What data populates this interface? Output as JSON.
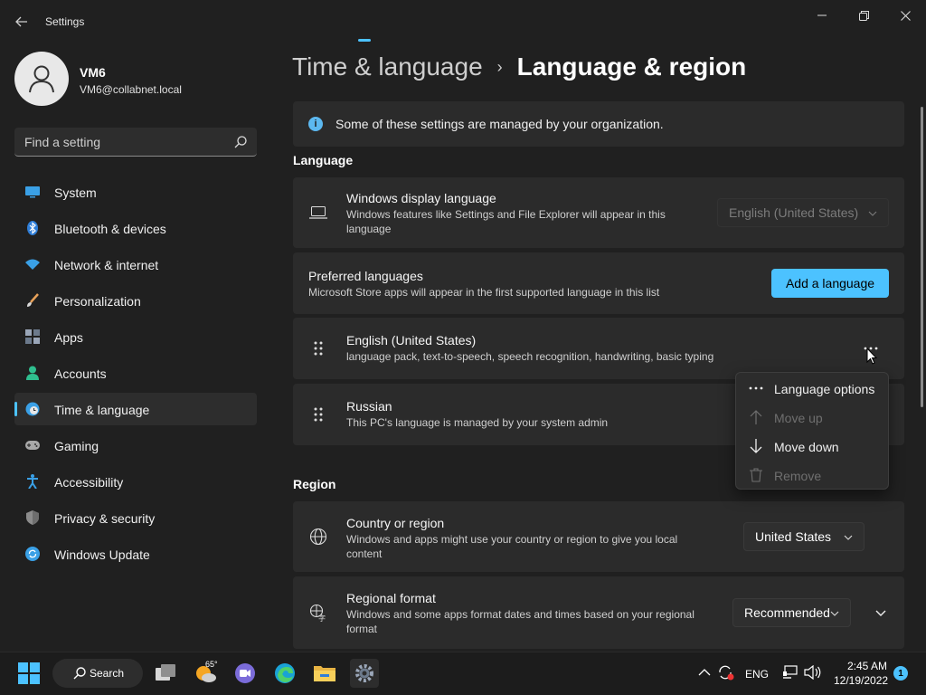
{
  "window": {
    "title": "Settings",
    "controls": [
      "minimize",
      "maximize",
      "close"
    ]
  },
  "profile": {
    "name": "VM6",
    "email": "VM6@collabnet.local"
  },
  "search": {
    "placeholder": "Find a setting",
    "value": ""
  },
  "sidebar": {
    "items": [
      {
        "label": "System",
        "icon": "monitor-icon",
        "active": false
      },
      {
        "label": "Bluetooth & devices",
        "icon": "bluetooth-icon",
        "active": false
      },
      {
        "label": "Network & internet",
        "icon": "wifi-icon",
        "active": false
      },
      {
        "label": "Personalization",
        "icon": "brush-icon",
        "active": false
      },
      {
        "label": "Apps",
        "icon": "apps-icon",
        "active": false
      },
      {
        "label": "Accounts",
        "icon": "person-icon",
        "active": false
      },
      {
        "label": "Time & language",
        "icon": "clock-globe-icon",
        "active": true
      },
      {
        "label": "Gaming",
        "icon": "gamepad-icon",
        "active": false
      },
      {
        "label": "Accessibility",
        "icon": "accessibility-icon",
        "active": false
      },
      {
        "label": "Privacy & security",
        "icon": "shield-icon",
        "active": false
      },
      {
        "label": "Windows Update",
        "icon": "update-icon",
        "active": false
      }
    ]
  },
  "breadcrumb": {
    "parent": "Time & language",
    "separator": "›",
    "current": "Language & region"
  },
  "info_bar": {
    "text": "Some of these settings are managed by your organization."
  },
  "language_section": {
    "heading": "Language",
    "display_language": {
      "title": "Windows display language",
      "description": "Windows features like Settings and File Explorer will appear in this language",
      "value": "English (United States)"
    },
    "preferred": {
      "title": "Preferred languages",
      "description": "Microsoft Store apps will appear in the first supported language in this list",
      "add_button": "Add a language"
    },
    "languages": [
      {
        "name": "English (United States)",
        "description": "language pack, text-to-speech, speech recognition, handwriting, basic typing"
      },
      {
        "name": "Russian",
        "description": "This PC's language is managed by your system admin"
      }
    ]
  },
  "context_menu": {
    "items": [
      {
        "label": "Language options",
        "icon": "more-icon",
        "enabled": true
      },
      {
        "label": "Move up",
        "icon": "arrow-up-icon",
        "enabled": false
      },
      {
        "label": "Move down",
        "icon": "arrow-down-icon",
        "enabled": true
      },
      {
        "label": "Remove",
        "icon": "trash-icon",
        "enabled": false
      }
    ]
  },
  "region_section": {
    "heading": "Region",
    "country": {
      "title": "Country or region",
      "description": "Windows and apps might use your country or region to give you local content",
      "value": "United States"
    },
    "format": {
      "title": "Regional format",
      "description": "Windows and some apps format dates and times based on your regional format",
      "value": "Recommended"
    }
  },
  "taskbar": {
    "search_label": "Search",
    "weather_temp": "65°",
    "language": "ENG",
    "time": "2:45 AM",
    "date": "12/19/2022",
    "notification_count": "1"
  },
  "colors": {
    "accent": "#4cc2ff",
    "background": "#202020",
    "card": "#2b2b2b"
  }
}
